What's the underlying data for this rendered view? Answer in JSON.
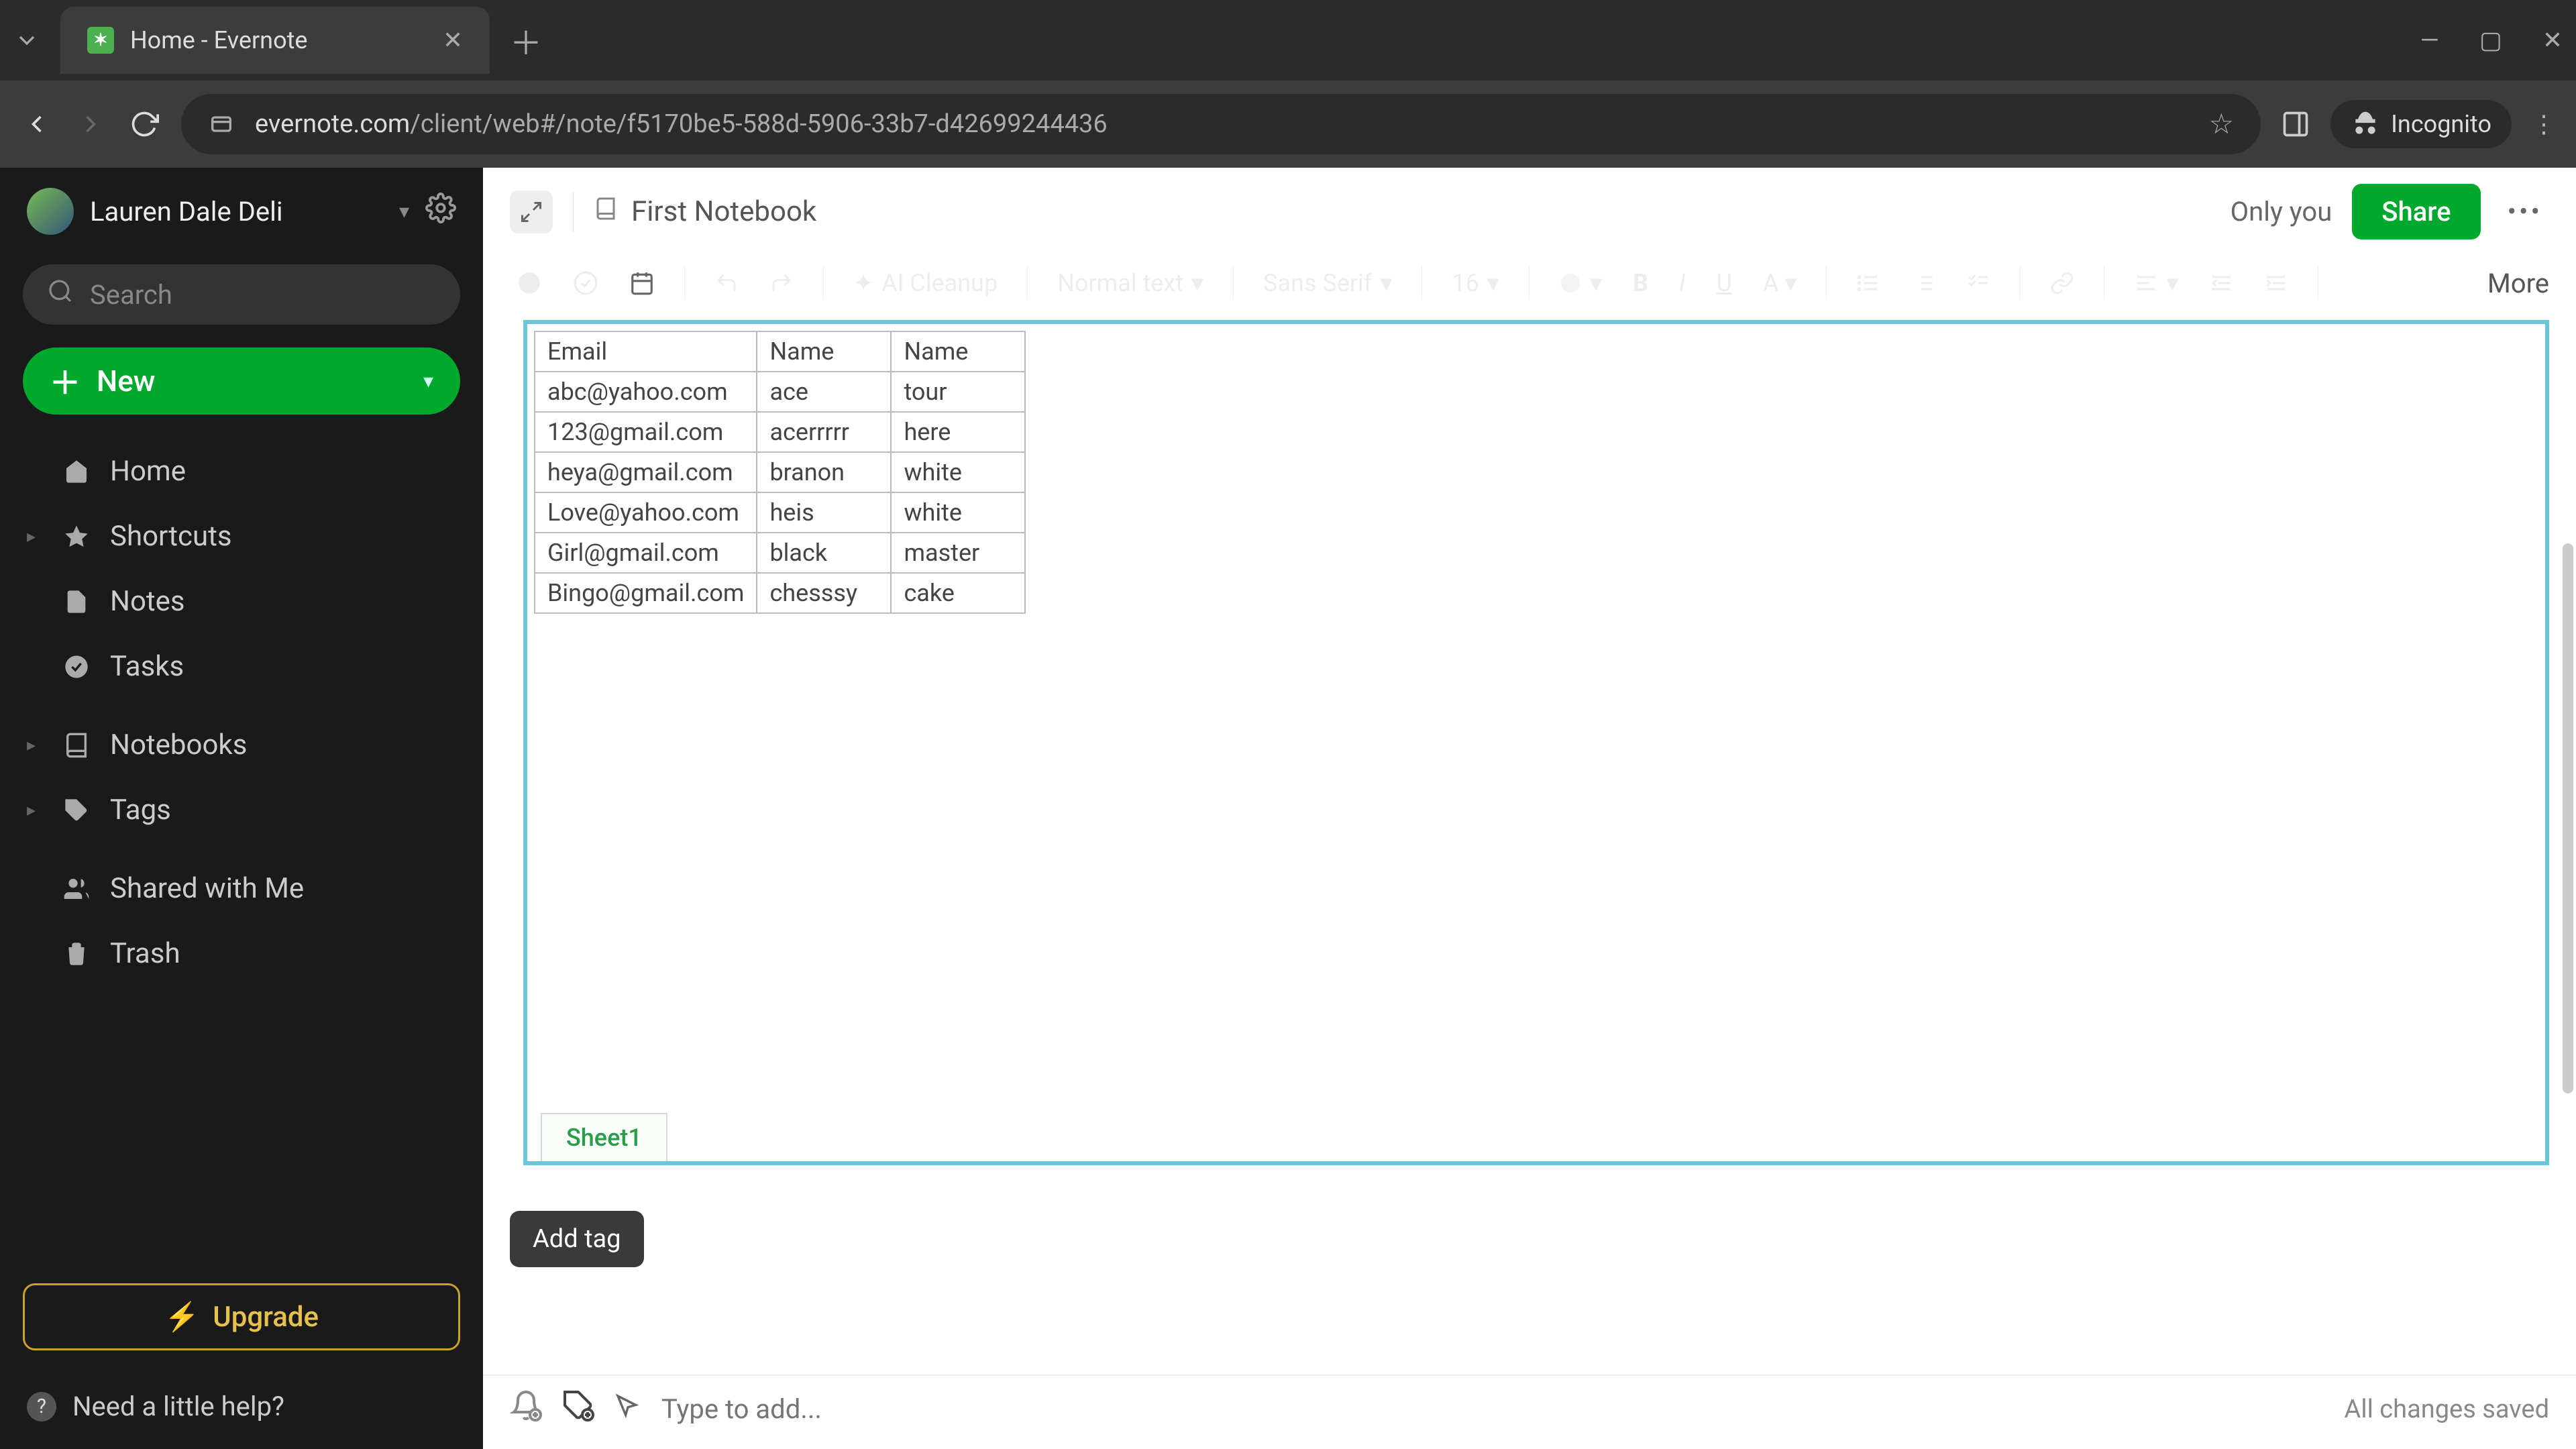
{
  "browser": {
    "tab_title": "Home - Evernote",
    "url_host": "evernote.com",
    "url_path": "/client/web#/note/f5170be5-588d-5906-33b7-d42699244436",
    "incognito_label": "Incognito"
  },
  "sidebar": {
    "username": "Lauren Dale Deli",
    "search_placeholder": "Search",
    "new_label": "New",
    "items": [
      {
        "icon": "home-icon",
        "label": "Home",
        "expandable": false
      },
      {
        "icon": "star-icon",
        "label": "Shortcuts",
        "expandable": true
      },
      {
        "icon": "note-icon",
        "label": "Notes",
        "expandable": false
      },
      {
        "icon": "check-circle-icon",
        "label": "Tasks",
        "expandable": false
      },
      {
        "icon": "notebook-icon",
        "label": "Notebooks",
        "expandable": true
      },
      {
        "icon": "tag-icon",
        "label": "Tags",
        "expandable": true
      },
      {
        "icon": "people-icon",
        "label": "Shared with Me",
        "expandable": false
      },
      {
        "icon": "trash-icon",
        "label": "Trash",
        "expandable": false
      }
    ],
    "upgrade_label": "Upgrade",
    "help_label": "Need a little help?"
  },
  "note_header": {
    "notebook_name": "First Notebook",
    "only_you": "Only you",
    "share_label": "Share"
  },
  "toolbar": {
    "ai_cleanup": "AI Cleanup",
    "para_style": "Normal text",
    "font_family": "Sans Serif",
    "font_size": "16",
    "more_label": "More"
  },
  "table": {
    "headers": [
      "Email",
      "Name",
      "Name"
    ],
    "rows": [
      [
        "abc@yahoo.com",
        "ace",
        "tour"
      ],
      [
        "123@gmail.com",
        "acerrrrr",
        "here"
      ],
      [
        "heya@gmail.com",
        "branon",
        "white"
      ],
      [
        "Love@yahoo.com",
        "heis",
        "white"
      ],
      [
        "Girl@gmail.com",
        "black",
        "master"
      ],
      [
        "Bingo@gmail.com",
        "chesssy",
        "cake"
      ]
    ],
    "sheet_tab": "Sheet1"
  },
  "footer": {
    "add_tag_tooltip": "Add tag",
    "tag_placeholder": "Type to add...",
    "save_status": "All changes saved"
  }
}
